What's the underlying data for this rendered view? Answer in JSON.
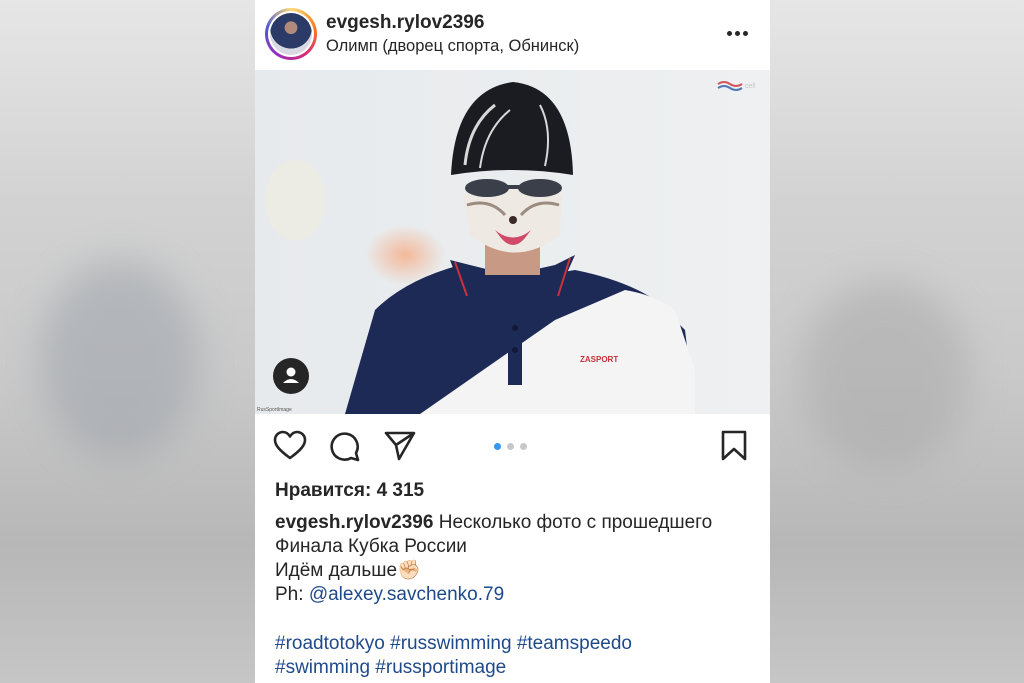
{
  "post": {
    "username": "evgesh.rylov2396",
    "location": "Олимп (дворец спорта, Обнинск)",
    "photo_credit": "RusSportImage",
    "photo_logo_text": "cell",
    "likes_label": "Нравится: 4 315",
    "caption": {
      "username": "evgesh.rylov2396",
      "line1": "Несколько фото с прошедшего",
      "line2": "Финала Кубка России",
      "line3": "Идём дальше",
      "emoji": "✊🏻",
      "ph_prefix": "Ph:",
      "ph_mention": "@alexey.savchenko.79"
    },
    "hashtags_line1": "#roadtotokyo #russwimming #teamspeedo",
    "hashtags_line2": "#swimming #russportimage",
    "shirt_brand": "ZASPORT",
    "carousel": {
      "total": 3,
      "active": 1
    }
  },
  "icons": {
    "more": "more-horizontal-icon",
    "like": "heart-icon",
    "comment": "comment-icon",
    "share": "send-icon",
    "save": "bookmark-icon",
    "tag": "user-tag-icon"
  },
  "colors": {
    "text": "#262626",
    "link": "#1f4a8a",
    "active_dot": "#3897f0"
  }
}
